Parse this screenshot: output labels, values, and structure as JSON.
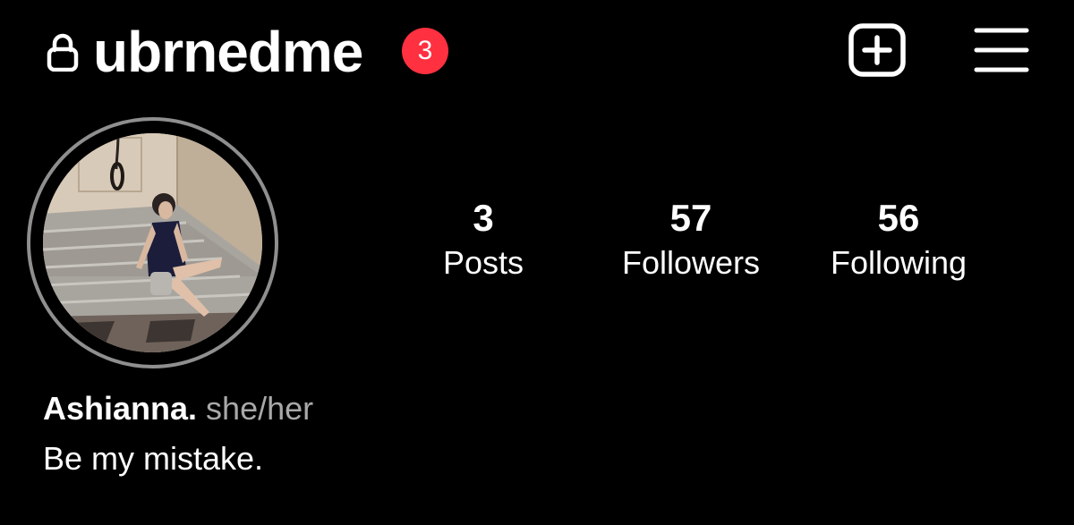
{
  "header": {
    "username": "ubrnedme",
    "notification_count": "3",
    "icons": {
      "lock": "lock-icon",
      "create": "plus-square-icon",
      "menu": "hamburger-menu-icon"
    }
  },
  "profile": {
    "display_name": "Ashianna.",
    "pronouns": "she/her",
    "bio": "Be my mistake."
  },
  "stats": {
    "posts": {
      "value": "3",
      "label": "Posts"
    },
    "followers": {
      "value": "57",
      "label": "Followers"
    },
    "following": {
      "value": "56",
      "label": "Following"
    }
  },
  "colors": {
    "background": "#000000",
    "text": "#ffffff",
    "muted_text": "#a8a8a8",
    "badge": "#ff3040",
    "avatar_ring": "#8f8f8f"
  }
}
